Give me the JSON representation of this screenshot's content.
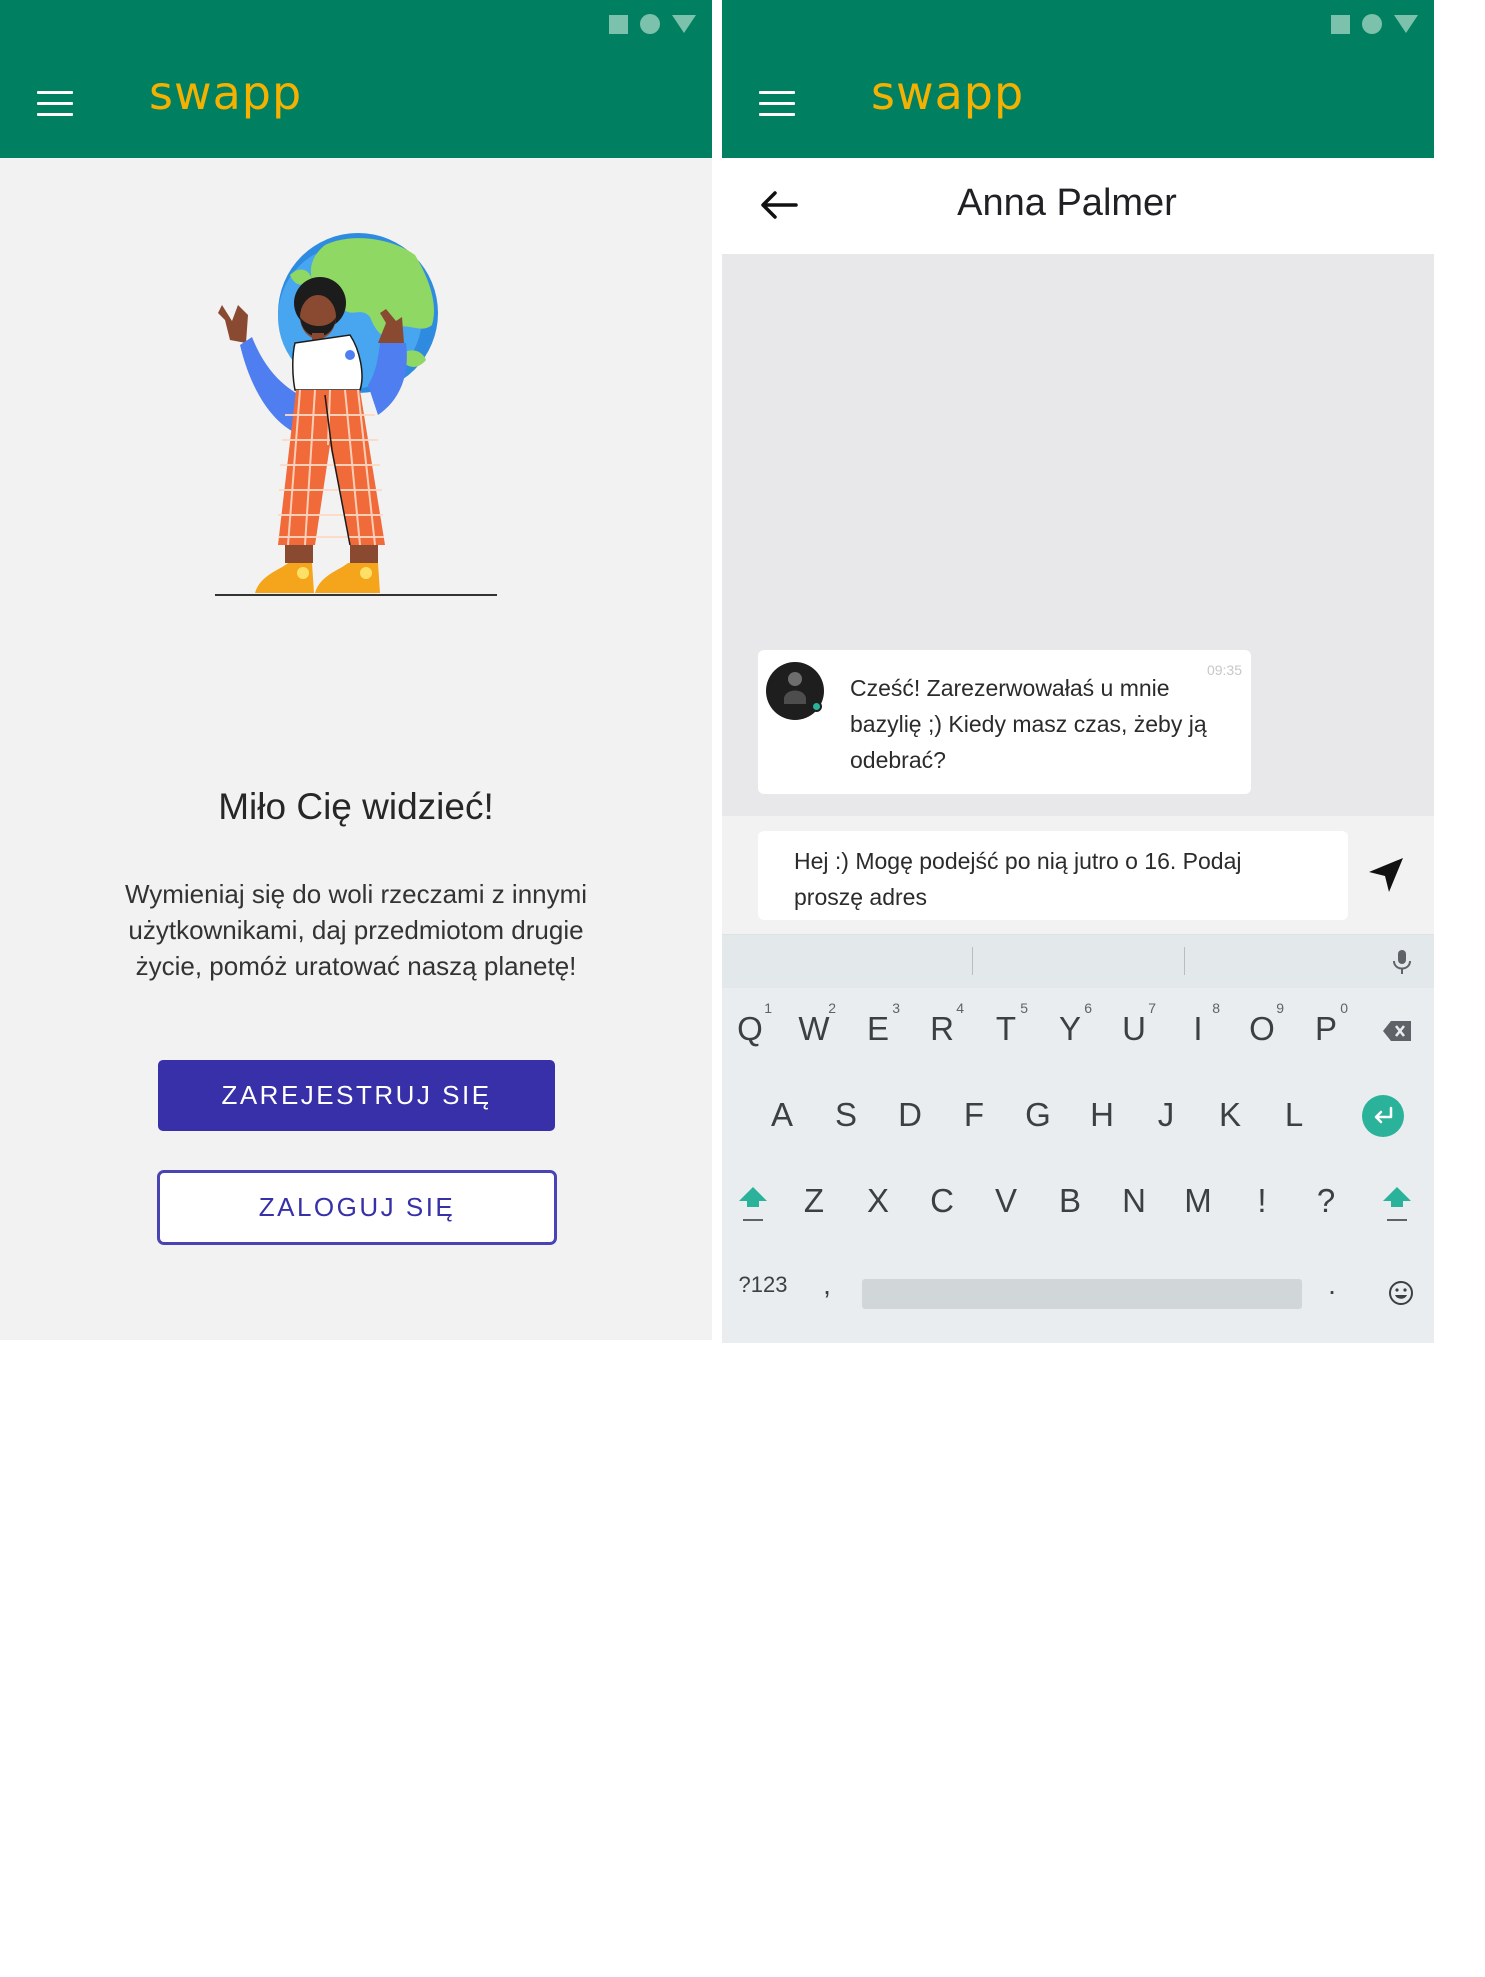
{
  "colors": {
    "brand_green": "#008061",
    "logo_yellow": "#f5b100",
    "primary_indigo": "#3730a8",
    "accent_teal": "#2ab29a"
  },
  "left_screen": {
    "app_logo": "swapp",
    "status_icons": [
      "square-icon",
      "circle-icon",
      "triangle-icon"
    ],
    "menu_icon": "hamburger-menu-icon",
    "illustration": "person-holding-globe-illustration",
    "title": "Miło Cię widzieć!",
    "description": "Wymieniaj się do woli rzeczami z innymi użytkownikami, daj przedmiotom drugie życie, pomóż uratować naszą planetę!",
    "register_label": "ZAREJESTRUJ SIĘ",
    "login_label": "ZALOGUJ SIĘ"
  },
  "right_screen": {
    "app_logo": "swapp",
    "menu_icon": "hamburger-menu-icon",
    "back_icon": "arrow-left-icon",
    "contact_name": "Anna Palmer",
    "message": {
      "time": "09:35",
      "text": "Cześć! Zarezerwowałaś u mnie bazylię ;) Kiedy masz czas, żeby ją odebrać?"
    },
    "compose_text": "Hej :) Mogę podejść po nią jutro o 16. Podaj proszę adres",
    "send_icon": "send-icon",
    "keyboard": {
      "row1": [
        "Q",
        "W",
        "E",
        "R",
        "T",
        "Y",
        "U",
        "I",
        "O",
        "P"
      ],
      "row1_hints": [
        "1",
        "2",
        "3",
        "4",
        "5",
        "6",
        "7",
        "8",
        "9",
        "0"
      ],
      "row2": [
        "A",
        "S",
        "D",
        "F",
        "G",
        "H",
        "J",
        "K",
        "L"
      ],
      "row3": [
        "Z",
        "X",
        "C",
        "V",
        "B",
        "N",
        "M",
        "!",
        "?"
      ],
      "symbols_label": "?123",
      "comma": ",",
      "period": "."
    }
  }
}
